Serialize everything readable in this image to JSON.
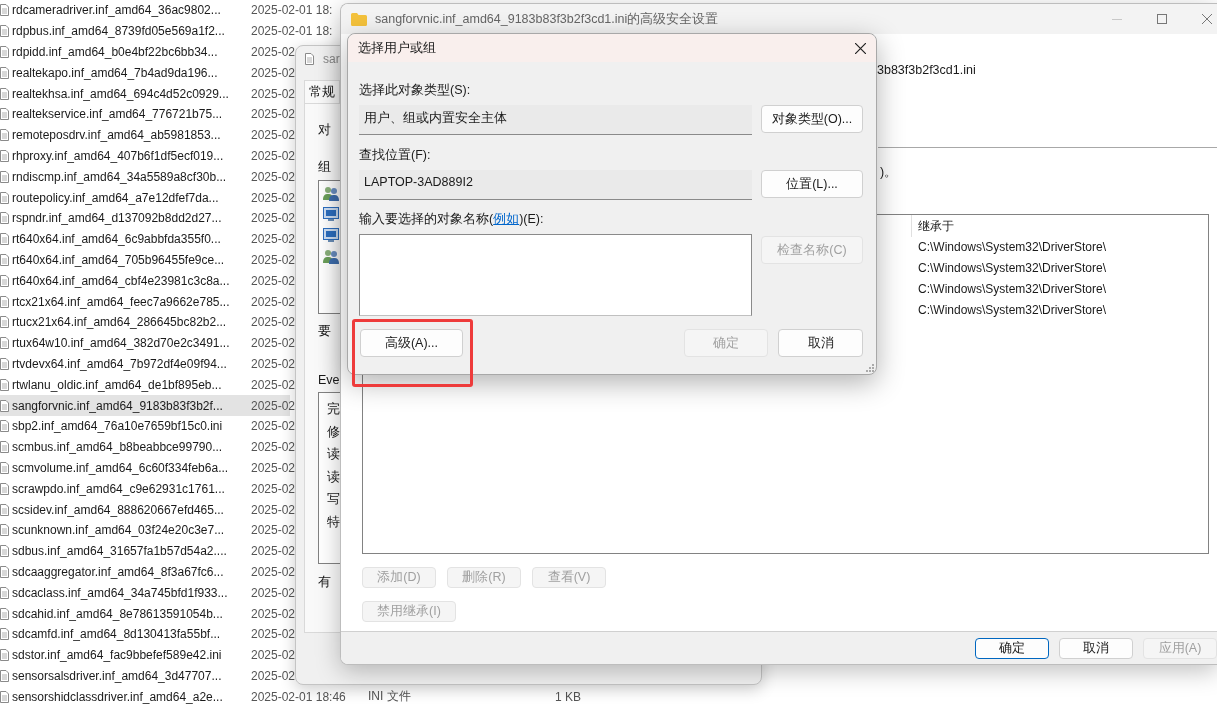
{
  "explorer": {
    "rows": [
      {
        "name": "rdcameradriver.inf_amd64_36ac9802...",
        "date": "2025-02-01 18:",
        "selected": false
      },
      {
        "name": "rdpbus.inf_amd64_8739fd05e569a1f2...",
        "date": "2025-02-01 18:",
        "selected": false
      },
      {
        "name": "rdpidd.inf_amd64_b0e4bf22bc6bb34...",
        "date": "2025-02",
        "selected": false
      },
      {
        "name": "realtekapo.inf_amd64_7b4ad9da196...",
        "date": "2025-02",
        "selected": false
      },
      {
        "name": "realtekhsa.inf_amd64_694c4d52c0929...",
        "date": "2025-02",
        "selected": false
      },
      {
        "name": "realtekservice.inf_amd64_776721b75...",
        "date": "2025-02",
        "selected": false
      },
      {
        "name": "remoteposdrv.inf_amd64_ab5981853...",
        "date": "2025-02",
        "selected": false
      },
      {
        "name": "rhproxy.inf_amd64_407b6f1df5ecf019...",
        "date": "2025-02",
        "selected": false
      },
      {
        "name": "rndiscmp.inf_amd64_34a5589a8cf30b...",
        "date": "2025-02",
        "selected": false
      },
      {
        "name": "routepolicy.inf_amd64_a7e12dfef7da...",
        "date": "2025-02",
        "selected": false
      },
      {
        "name": "rspndr.inf_amd64_d137092b8dd2d27...",
        "date": "2025-02",
        "selected": false
      },
      {
        "name": "rt640x64.inf_amd64_6c9abbfda355f0...",
        "date": "2025-02",
        "selected": false
      },
      {
        "name": "rt640x64.inf_amd64_705b96455fe9ce...",
        "date": "2025-02",
        "selected": false
      },
      {
        "name": "rt640x64.inf_amd64_cbf4e23981c3c8a...",
        "date": "2025-02",
        "selected": false
      },
      {
        "name": "rtcx21x64.inf_amd64_feec7a9662e785...",
        "date": "2025-02",
        "selected": false
      },
      {
        "name": "rtucx21x64.inf_amd64_286645bc82b2...",
        "date": "2025-02",
        "selected": false
      },
      {
        "name": "rtux64w10.inf_amd64_382d70e2c3491...",
        "date": "2025-02",
        "selected": false
      },
      {
        "name": "rtvdevx64.inf_amd64_7b972df4e09f94...",
        "date": "2025-02",
        "selected": false
      },
      {
        "name": "rtwlanu_oldic.inf_amd64_de1bf895eb...",
        "date": "2025-02",
        "selected": false
      },
      {
        "name": "sangforvnic.inf_amd64_9183b83f3b2f...",
        "date": "2025-02",
        "selected": true
      },
      {
        "name": "sbp2.inf_amd64_76a10e7659bf15c0.ini",
        "date": "2025-02",
        "selected": false
      },
      {
        "name": "scmbus.inf_amd64_b8beabbce99790...",
        "date": "2025-02",
        "selected": false
      },
      {
        "name": "scmvolume.inf_amd64_6c60f334feb6a...",
        "date": "2025-02",
        "selected": false
      },
      {
        "name": "scrawpdo.inf_amd64_c9e62931c1761...",
        "date": "2025-02",
        "selected": false
      },
      {
        "name": "scsidev.inf_amd64_888620667efd465...",
        "date": "2025-02",
        "selected": false
      },
      {
        "name": "scunknown.inf_amd64_03f24e20c3e7...",
        "date": "2025-02",
        "selected": false
      },
      {
        "name": "sdbus.inf_amd64_31657fa1b57d54a2....",
        "date": "2025-02",
        "selected": false
      },
      {
        "name": "sdcaaggregator.inf_amd64_8f3a67fc6...",
        "date": "2025-02",
        "selected": false
      },
      {
        "name": "sdcaclass.inf_amd64_34a745bfd1f933...",
        "date": "2025-02",
        "selected": false
      },
      {
        "name": "sdcahid.inf_amd64_8e78613591054b...",
        "date": "2025-02",
        "selected": false
      },
      {
        "name": "sdcamfd.inf_amd64_8d130413fa55bf...",
        "date": "2025-02",
        "selected": false
      },
      {
        "name": "sdstor.inf_amd64_fac9bbefef589e42.ini",
        "date": "2025-02",
        "selected": false
      },
      {
        "name": "sensorsalsdriver.inf_amd64_3d47707...",
        "date": "2025-02",
        "selected": false
      },
      {
        "name": "sensorshidclassdriver.inf_amd64_a2e...",
        "date": "2025-02-01 18:46",
        "type": "INI 文件",
        "size": "1 KB",
        "selected": false
      }
    ]
  },
  "properties_window": {
    "title": "sar",
    "tabs": [
      {
        "label": "常规",
        "selected": true
      }
    ],
    "labels": [
      "对",
      "组",
      "要",
      "Eve",
      "有"
    ],
    "principals": [
      {
        "kind": "group"
      },
      {
        "kind": "computer"
      },
      {
        "kind": "computer"
      },
      {
        "kind": "group"
      }
    ],
    "permissions": [
      "完",
      "修",
      "读",
      "读",
      "写",
      "特"
    ]
  },
  "advanced_window": {
    "title": "sangforvnic.inf_amd64_9183b83f3b2f3cd1.ini的高级安全设置",
    "name_fragment": "3b83f3b2f3cd1.ini",
    "note_fragment": ")。",
    "table": {
      "column": "继承于",
      "rows": [
        "C:\\Windows\\System32\\DriverStore\\",
        "C:\\Windows\\System32\\DriverStore\\",
        "C:\\Windows\\System32\\DriverStore\\",
        "C:\\Windows\\System32\\DriverStore\\"
      ]
    },
    "entry_buttons": [
      {
        "label": "添加(D)",
        "disabled": true
      },
      {
        "label": "删除(R)",
        "disabled": true
      },
      {
        "label": "查看(V)",
        "disabled": true
      }
    ],
    "inheritance_button": {
      "label": "禁用继承(I)",
      "disabled": true
    },
    "footer_buttons": [
      {
        "label": "确定",
        "default": true,
        "disabled": false
      },
      {
        "label": "取消",
        "default": false,
        "disabled": false
      },
      {
        "label": "应用(A)",
        "default": false,
        "disabled": true
      }
    ]
  },
  "dialog": {
    "title": "选择用户或组",
    "type_label": "选择此对象类型(S):",
    "type_value": "用户、组或内置安全主体",
    "type_button": {
      "label": "对象类型(O)...",
      "disabled": false
    },
    "location_label": "查找位置(F):",
    "location_value": "LAPTOP-3AD889I2",
    "location_button": {
      "label": "位置(L)...",
      "disabled": false
    },
    "name_label": {
      "before": "输入要选择的对象名称(",
      "link": "例如",
      "after": ")(E):"
    },
    "check_button": {
      "label": "检查名称(C)",
      "disabled": true
    },
    "advanced_button": {
      "label": "高级(A)...",
      "disabled": false,
      "highlighted": true
    },
    "ok_button": {
      "label": "确定",
      "disabled": true
    },
    "cancel_button": {
      "label": "取消",
      "disabled": false
    }
  }
}
